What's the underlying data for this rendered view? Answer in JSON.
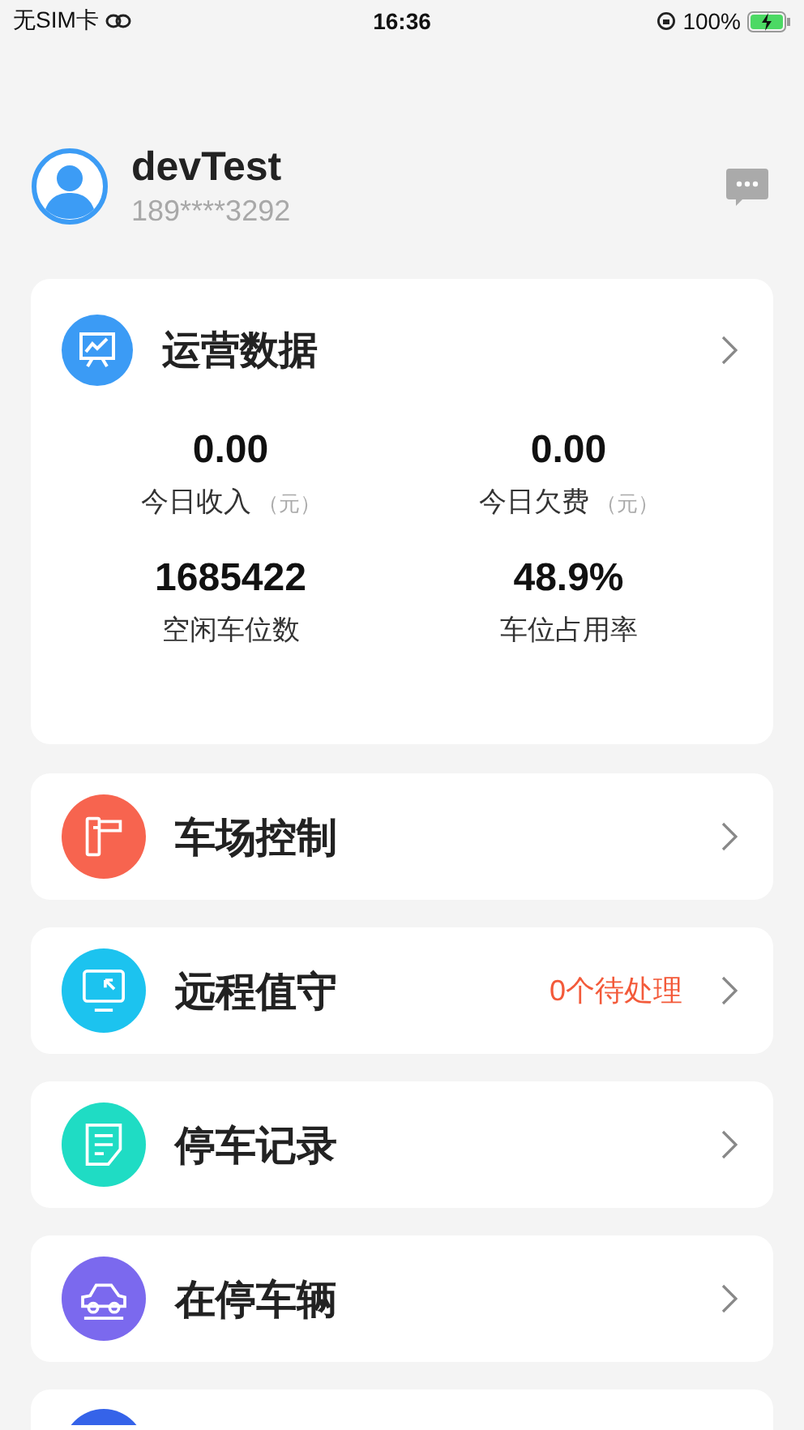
{
  "status_bar": {
    "carrier": "无SIM卡",
    "time": "16:36",
    "battery": "100%"
  },
  "profile": {
    "name": "devTest",
    "phone": "189****3292"
  },
  "operations": {
    "title": "运营数据",
    "stats": [
      {
        "value": "0.00",
        "label": "今日收入",
        "unit": "（元）"
      },
      {
        "value": "0.00",
        "label": "今日欠费",
        "unit": "（元）"
      },
      {
        "value": "1685422",
        "label": "空闲车位数"
      },
      {
        "value": "48.9%",
        "label": "车位占用率"
      }
    ]
  },
  "menu": [
    {
      "kind": "gate",
      "label": "车场控制",
      "color": "#f7644f"
    },
    {
      "kind": "monitor",
      "label": "远程值守",
      "color": "#1cc3ef",
      "badge": "0个待处理"
    },
    {
      "kind": "record",
      "label": "停车记录",
      "color": "#1fdcc4"
    },
    {
      "kind": "car",
      "label": "在停车辆",
      "color": "#7b69ee"
    },
    {
      "kind": "cut",
      "color": "#3563e9"
    }
  ]
}
